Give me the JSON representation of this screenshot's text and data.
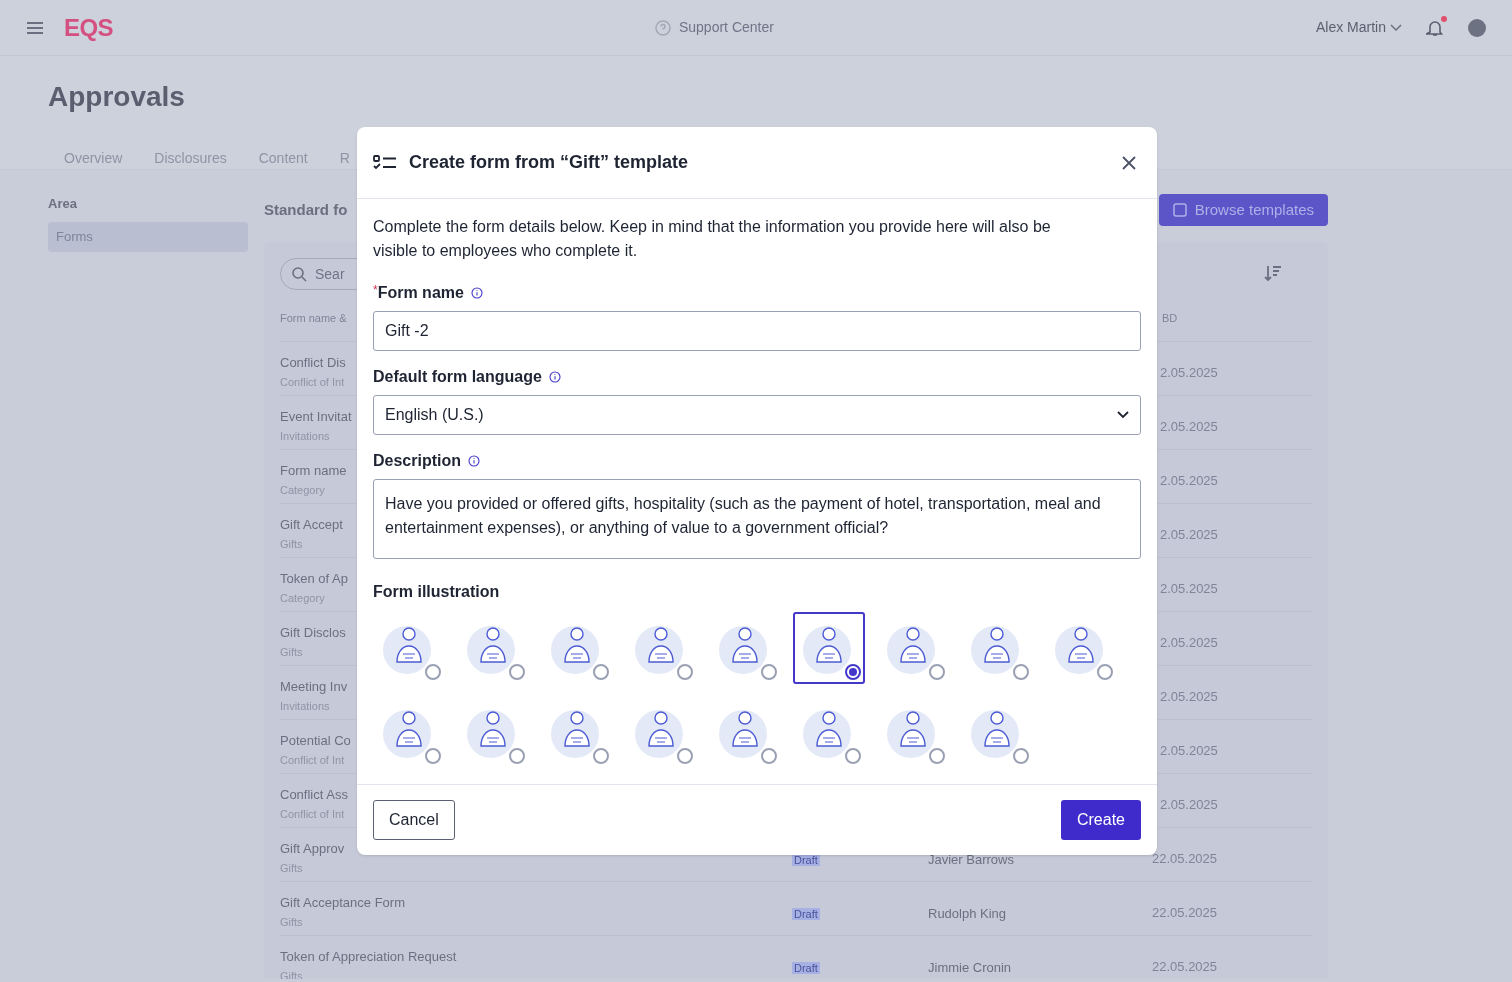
{
  "header": {
    "logo": "EQS",
    "support": "Support Center",
    "user": "Alex Martin",
    "notification_unread": true
  },
  "page": {
    "title": "Approvals",
    "tabs": [
      "Overview",
      "Disclosures",
      "Content",
      "R"
    ]
  },
  "sidebar": {
    "heading": "Area",
    "items": [
      {
        "label": "Forms",
        "selected": true
      }
    ]
  },
  "content": {
    "title": "Standard fo",
    "browse_button": "Browse templates",
    "search_placeholder": "Sear",
    "columns": {
      "name": "Form name &",
      "date": "BD"
    },
    "rows": [
      {
        "name": "Conflict Dis",
        "category": "Conflict of Int",
        "date": "2.05.2025"
      },
      {
        "name": "Event Invitat",
        "category": "Invitations",
        "date": "2.05.2025"
      },
      {
        "name": "Form name",
        "category": "Category",
        "date": "2.05.2025"
      },
      {
        "name": "Gift Accept",
        "category": "Gifts",
        "date": "2.05.2025"
      },
      {
        "name": "Token of Ap",
        "category": "Category",
        "date": "2.05.2025"
      },
      {
        "name": "Gift Disclos",
        "category": "Gifts",
        "date": "2.05.2025"
      },
      {
        "name": "Meeting Inv",
        "category": "Invitations",
        "date": "2.05.2025"
      },
      {
        "name": "Potential Co",
        "category": "Conflict of Int",
        "date": "2.05.2025"
      },
      {
        "name": "Conflict Ass",
        "category": "Conflict of Int",
        "date": "2.05.2025"
      },
      {
        "name": "Gift Approv",
        "category": "Gifts",
        "status": "Draft",
        "owner": "Javier Barrows",
        "date": "22.05.2025"
      },
      {
        "name": "Gift Acceptance Form",
        "category": "Gifts",
        "status": "Draft",
        "owner": "Rudolph King",
        "date": "22.05.2025"
      },
      {
        "name": "Token of Appreciation Request",
        "category": "Gifts",
        "status": "Draft",
        "owner": "Jimmie Cronin",
        "date": "22.05.2025"
      }
    ]
  },
  "dialog": {
    "title": "Create form from “Gift” template",
    "intro": "Complete the form details below. Keep in mind that the information you provide here will also be visible to employees who complete it.",
    "fields": [
      {
        "kind": "text",
        "label": "Form name",
        "required_mark": "*",
        "value": "Gift -2"
      },
      {
        "kind": "select",
        "label": "Default form language",
        "value": "English (U.S.)"
      },
      {
        "kind": "textarea",
        "label": "Description",
        "value": "Have you provided or offered gifts, hospitality (such as the payment of hotel, transportation, meal and entertainment expenses), or anything of value to a government official?"
      }
    ],
    "illustrations": {
      "label": "Form illustration",
      "options": [
        {
          "selected": false
        },
        {
          "selected": false
        },
        {
          "selected": false
        },
        {
          "selected": false
        },
        {
          "selected": false
        },
        {
          "selected": true
        },
        {
          "selected": false
        },
        {
          "selected": false
        },
        {
          "selected": false
        },
        {
          "selected": false
        },
        {
          "selected": false
        },
        {
          "selected": false
        },
        {
          "selected": false
        },
        {
          "selected": false
        },
        {
          "selected": false
        },
        {
          "selected": false
        },
        {
          "selected": false
        }
      ]
    },
    "cancel": "Cancel",
    "create": "Create"
  }
}
